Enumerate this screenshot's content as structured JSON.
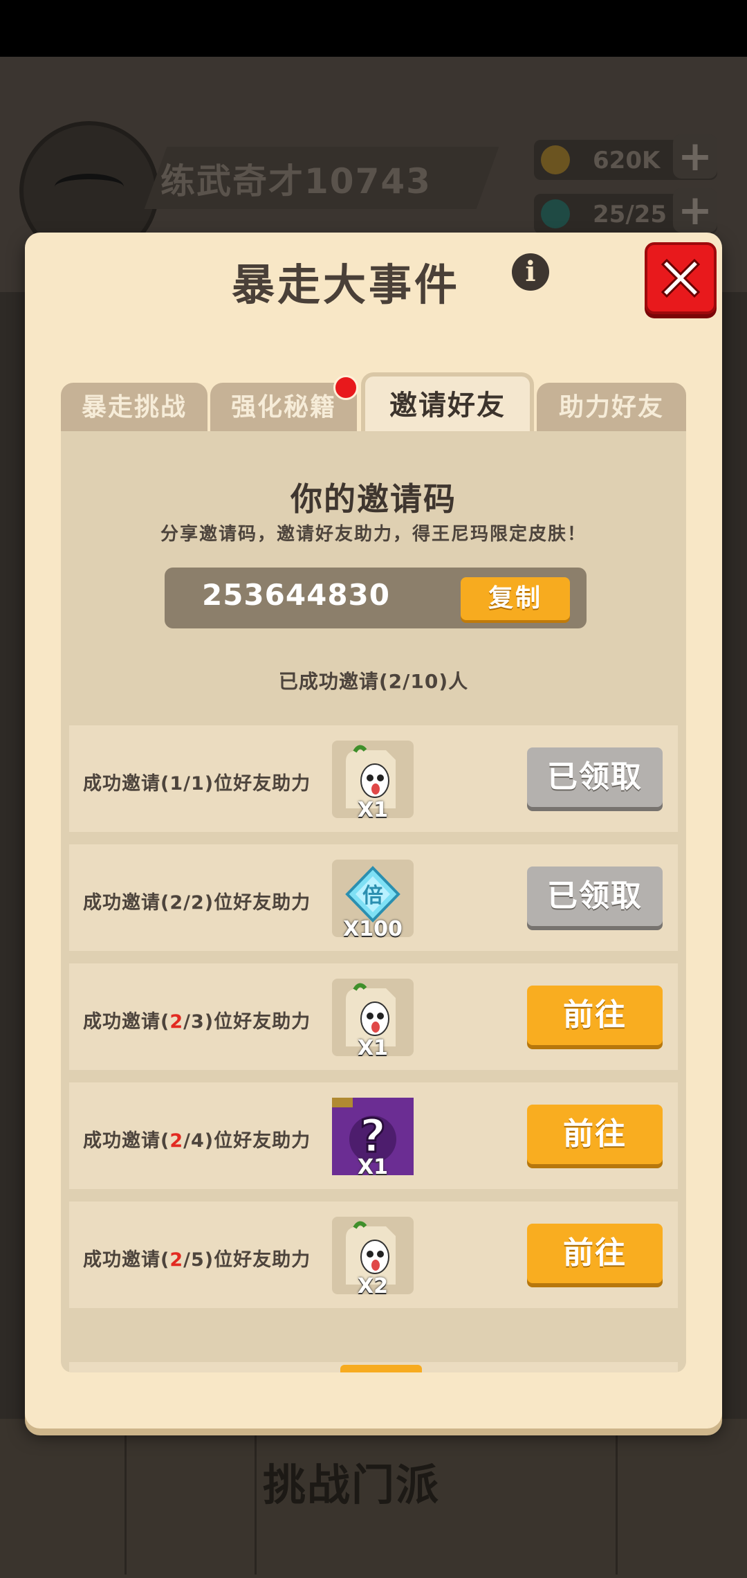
{
  "background": {
    "player_name": "练武奇才10743",
    "gold": "620K",
    "stamina": "25/25",
    "plus_label": "+",
    "bottom_tab": "挑战门派"
  },
  "modal": {
    "title": "暴走大事件",
    "info_glyph": "i",
    "tabs": [
      {
        "label": "暴走挑战",
        "active": false,
        "badge": false
      },
      {
        "label": "强化秘籍",
        "active": false,
        "badge": true
      },
      {
        "label": "邀请好友",
        "active": true,
        "badge": false
      },
      {
        "label": "助力好友",
        "active": false,
        "badge": false
      }
    ],
    "invite": {
      "title": "你的邀请码",
      "subtitle": "分享邀请码，邀请好友助力，得王尼玛限定皮肤！",
      "code": "253644830",
      "copy_label": "复制",
      "invited": "已成功邀请(2/10)人"
    },
    "rows": [
      {
        "prefix": "成功邀请(",
        "current": "1",
        "rest": "/1)位好友助力",
        "highlight": false,
        "reward": "ghost",
        "qty": "X1",
        "button": "已领取",
        "state": "claimed"
      },
      {
        "prefix": "成功邀请(",
        "current": "2",
        "rest": "/2)位好友助力",
        "highlight": false,
        "reward": "diamond",
        "qty": "X100",
        "button": "已领取",
        "state": "claimed"
      },
      {
        "prefix": "成功邀请(",
        "current": "2",
        "rest": "/3)位好友助力",
        "highlight": true,
        "reward": "ghost",
        "qty": "X1",
        "button": "前往",
        "state": "goto"
      },
      {
        "prefix": "成功邀请(",
        "current": "2",
        "rest": "/4)位好友助力",
        "highlight": true,
        "reward": "mystery",
        "qty": "X1",
        "button": "前往",
        "state": "goto"
      },
      {
        "prefix": "成功邀请(",
        "current": "2",
        "rest": "/5)位好友助力",
        "highlight": true,
        "reward": "ghost",
        "qty": "X2",
        "button": "前往",
        "state": "goto"
      }
    ],
    "colors": {
      "accent_orange": "#f9ad20",
      "close_red": "#e8191c",
      "highlight_red": "#e22a21",
      "claimed_gray": "#b4b1ae"
    }
  }
}
